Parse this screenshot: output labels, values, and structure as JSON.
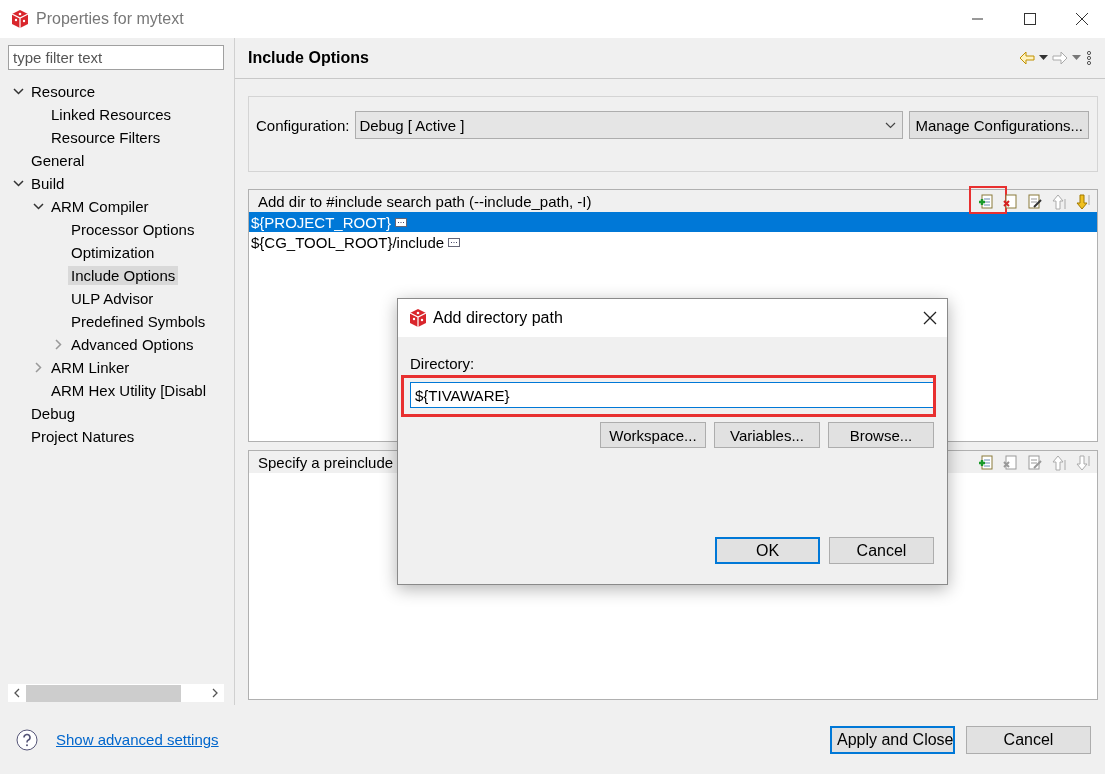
{
  "window": {
    "title": "Properties for mytext"
  },
  "filter": {
    "placeholder": "type filter text"
  },
  "tree": [
    {
      "label": "Resource",
      "expanded": true,
      "selected": false,
      "children": [
        {
          "label": "Linked Resources",
          "selected": false
        },
        {
          "label": "Resource Filters",
          "selected": false
        }
      ]
    },
    {
      "label": "General",
      "selected": false
    },
    {
      "label": "Build",
      "expanded": true,
      "selected": false,
      "children": [
        {
          "label": "ARM Compiler",
          "expanded": true,
          "selected": false,
          "children": [
            {
              "label": "Processor Options",
              "selected": false
            },
            {
              "label": "Optimization",
              "selected": false
            },
            {
              "label": "Include Options",
              "selected": true
            },
            {
              "label": "ULP Advisor",
              "selected": false
            },
            {
              "label": "Predefined Symbols",
              "selected": false
            },
            {
              "label": "Advanced Options",
              "expanded": false,
              "selected": false
            }
          ]
        },
        {
          "label": "ARM Linker",
          "expanded": false,
          "selected": false
        },
        {
          "label": "ARM Hex Utility  [Disabl",
          "selected": false
        }
      ]
    },
    {
      "label": "Debug",
      "selected": false
    },
    {
      "label": "Project Natures",
      "selected": false
    }
  ],
  "page": {
    "title": "Include Options"
  },
  "configuration": {
    "label": "Configuration:",
    "value": "Debug  [ Active ]",
    "button": "Manage Configurations..."
  },
  "lists": [
    {
      "title": "Add dir to #include search path (--include_path, -I)",
      "tools": [
        {
          "kind": "add",
          "disabled": false,
          "highlighted": true
        },
        {
          "kind": "delete",
          "disabled": false,
          "highlighted": false
        },
        {
          "kind": "edit",
          "disabled": false,
          "highlighted": false
        },
        {
          "kind": "up",
          "disabled": true,
          "highlighted": false
        },
        {
          "kind": "down",
          "disabled": false,
          "highlighted": false
        }
      ],
      "items": [
        {
          "text": "${PROJECT_ROOT}",
          "selected": true
        },
        {
          "text": "${CG_TOOL_ROOT}/include",
          "selected": false
        }
      ]
    },
    {
      "title": "Specify a preinclude",
      "tools": [
        {
          "kind": "add",
          "disabled": false,
          "highlighted": false
        },
        {
          "kind": "delete",
          "disabled": true,
          "highlighted": false
        },
        {
          "kind": "edit",
          "disabled": true,
          "highlighted": false
        },
        {
          "kind": "up",
          "disabled": true,
          "highlighted": false
        },
        {
          "kind": "down",
          "disabled": true,
          "highlighted": false
        }
      ]
    }
  ],
  "dialog": {
    "title": "Add directory path",
    "field_label": "Directory:",
    "value": "${TIVAWARE}",
    "highlighted": true,
    "buttons": [
      "Workspace...",
      "Variables...",
      "Browse..."
    ],
    "ok": "OK",
    "cancel": "Cancel"
  },
  "footer": {
    "link": "Show advanced settings",
    "buttons": [
      {
        "label": "Apply and Close",
        "default": true
      },
      {
        "label": "Cancel",
        "default": false
      }
    ]
  }
}
